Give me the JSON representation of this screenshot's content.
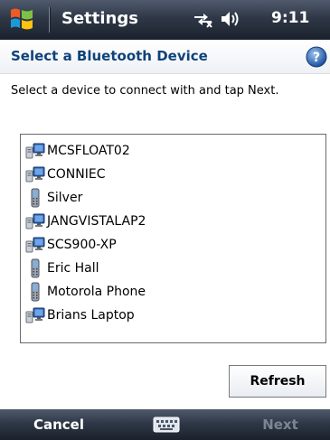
{
  "titlebar": {
    "title": "Settings",
    "time": "9:11",
    "icons": [
      "windows-start-icon",
      "network-connectivity-icon",
      "volume-icon"
    ]
  },
  "header": {
    "title": "Select a Bluetooth Device",
    "help_icon": "help-icon"
  },
  "instruction": "Select a device to connect with and tap Next.",
  "devices": [
    {
      "name": "MCSFLOAT02",
      "icon": "computer-icon"
    },
    {
      "name": "CONNIEC",
      "icon": "computer-icon"
    },
    {
      "name": "Silver",
      "icon": "phone-icon"
    },
    {
      "name": "JANGVISTALAP2",
      "icon": "computer-icon"
    },
    {
      "name": "SCS900-XP",
      "icon": "computer-icon"
    },
    {
      "name": "Eric Hall",
      "icon": "phone-icon"
    },
    {
      "name": "Motorola Phone",
      "icon": "phone-icon"
    },
    {
      "name": "Brians Laptop",
      "icon": "computer-icon"
    }
  ],
  "refresh_label": "Refresh",
  "softkeys": {
    "left": "Cancel",
    "right": "Next",
    "sip_icon": "keyboard-icon"
  },
  "colors": {
    "titlebar": "#2f3847",
    "header_title": "#10427a",
    "disabled_softkey": "#7c8594"
  }
}
